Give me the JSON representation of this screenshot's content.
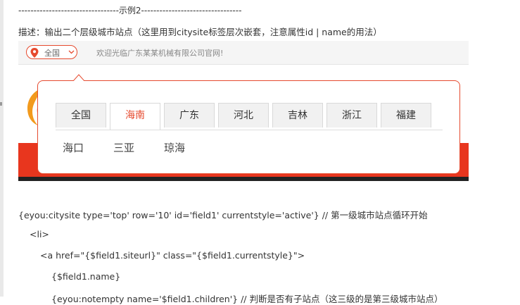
{
  "separator": "---------------------------------示例2---------------------------------",
  "description": "描述：输出二个层级城市站点（这里用到citysite标签层次嵌套，注意属性id | name的用法）",
  "topbar": {
    "city_button_label": "全国",
    "welcome_text": "欢迎光临广东某某机械有限公司官网!"
  },
  "popup": {
    "tabs": [
      {
        "label": "全国",
        "active": false
      },
      {
        "label": "海南",
        "active": true
      },
      {
        "label": "广东",
        "active": false
      },
      {
        "label": "河北",
        "active": false
      },
      {
        "label": "吉林",
        "active": false
      },
      {
        "label": "浙江",
        "active": false
      },
      {
        "label": "福建",
        "active": false
      }
    ],
    "cities": [
      "海口",
      "三亚",
      "琼海"
    ]
  },
  "code_lines": [
    "{eyou:citysite type='top' row='10' id='field1' currentstyle='active'} // 第一级城市站点循环开始",
    "<li>",
    "<a href=\"{$field1.siteurl}\" class=\"{$field1.currentstyle}\">",
    "{$field1.name}",
    "{eyou:notempty name='$field1.children'} // 判断是否有子站点（这三级的是第三级城市站点）"
  ],
  "colors": {
    "accent": "#e64a2e",
    "banner_red": "#e8361e",
    "banner_dark": "#222222",
    "tab_bg": "#f1f1f1"
  }
}
